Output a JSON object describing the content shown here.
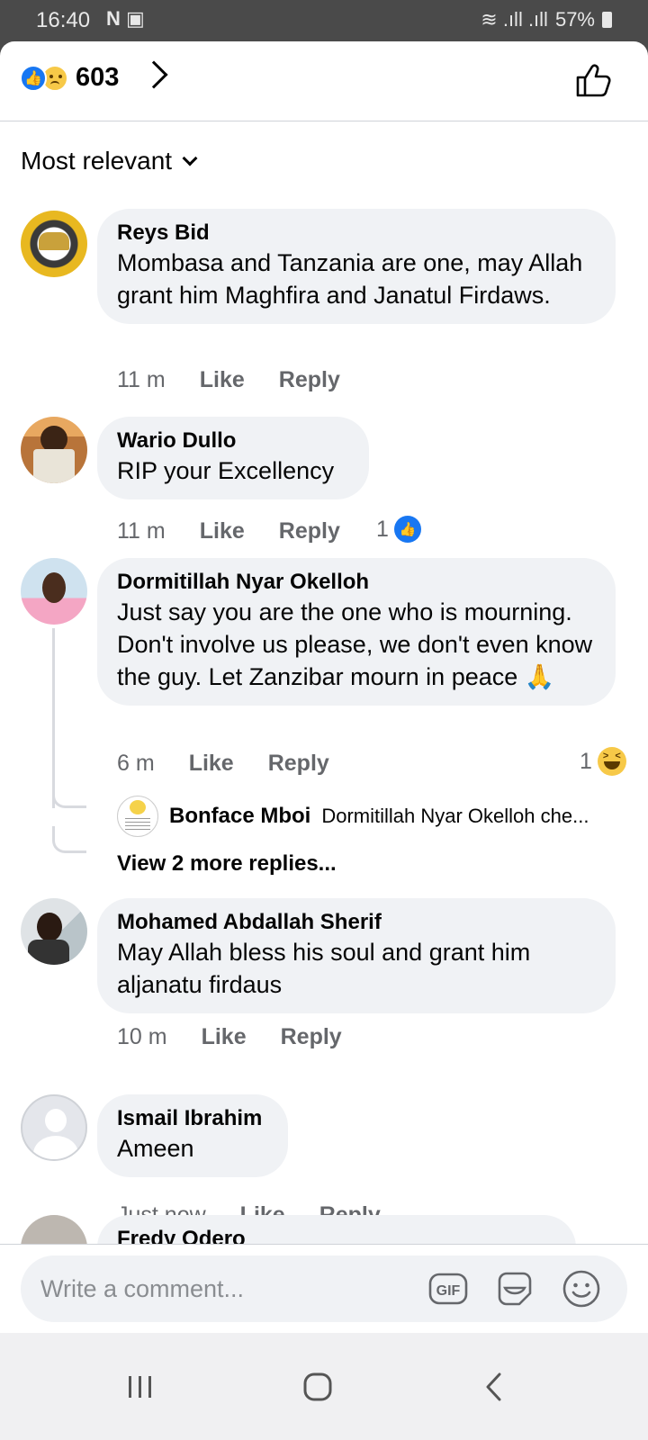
{
  "status_bar": {
    "time": "16:40",
    "left_icons": "N ▣",
    "signal": "≋ .ıll .ıll",
    "battery": "57%"
  },
  "header": {
    "reaction_count": "603"
  },
  "sort": {
    "label": "Most relevant"
  },
  "comments": [
    {
      "name": "Reys Bid",
      "text": "Mombasa and Tanzania are one, may Allah grant him Maghfira and Janatul Firdaws.",
      "time": "11 m",
      "like": "Like",
      "reply": "Reply"
    },
    {
      "name": "Wario Dullo",
      "text": "RIP your Excellency",
      "time": "11 m",
      "like": "Like",
      "reply": "Reply",
      "reactions": "1"
    },
    {
      "name": "Dormitillah Nyar Okelloh",
      "text": "Just say you are the one who is mourning. Don't involve us please, we don't even know the guy. Let Zanzibar mourn in peace 🙏",
      "time": "6 m",
      "like": "Like",
      "reply": "Reply",
      "reactions": "1",
      "reply_preview": {
        "name": "Bonface Mboi",
        "text": "Dormitillah Nyar Okelloh che..."
      },
      "more_replies": "View 2 more replies..."
    },
    {
      "name": "Mohamed Abdallah Sherif",
      "text": "May Allah bless his soul and grant him aljanatu firdaus",
      "time": "10 m",
      "like": "Like",
      "reply": "Reply"
    },
    {
      "name": "Ismail Ibrahim",
      "text": "Ameen",
      "time": "Just now",
      "like": "Like",
      "reply": "Reply"
    },
    {
      "name": "Fredy Odero"
    }
  ],
  "composer": {
    "placeholder": "Write a comment...",
    "gif_label": "GIF"
  },
  "colors": {
    "accent": "#1877f2",
    "bubble": "#f0f2f5",
    "meta_text": "#65676b"
  }
}
